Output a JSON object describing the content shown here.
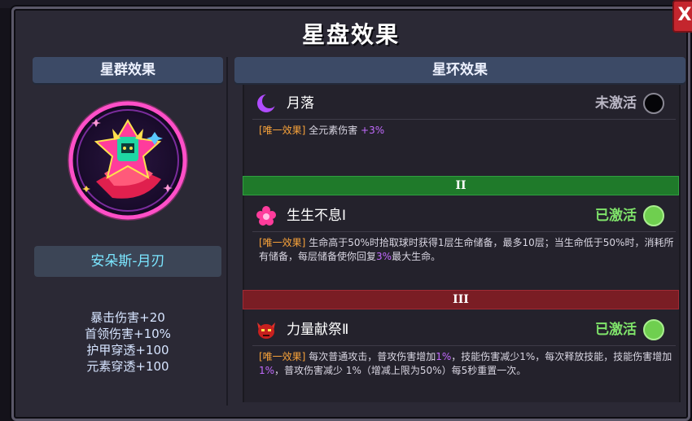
{
  "window": {
    "title": "星盘效果",
    "close_label": "X"
  },
  "left": {
    "header": "星群效果",
    "set_name": "安朵斯-月刃",
    "stats": [
      "暴击伤害+20",
      "首领伤害+10%",
      "护甲穿透+100",
      "元素穿透+100"
    ]
  },
  "right": {
    "header": "星环效果",
    "rings": [
      {
        "name": "月落",
        "status": "未激活",
        "status_color": "#b9b6c4",
        "icon": "crescent-moon-icon",
        "tag": "[唯一效果]",
        "desc_parts": [
          "全元素伤害 ",
          "+3%",
          ""
        ]
      },
      {
        "tier": "II",
        "tier_color": "#1f7a2a",
        "name": "生生不息Ⅰ",
        "status": "已激活",
        "status_color": "#7fe36a",
        "icon": "flower-icon",
        "tag": "[唯一效果]",
        "desc_parts": [
          "生命高于50%时拾取球时获得1层生命储备，最多10层；当生命低于50%时，消耗所有储备，每层储备使你回复",
          "3%",
          "最大生命。"
        ]
      },
      {
        "tier": "III",
        "tier_color": "#7a1d24",
        "name": "力量献祭Ⅱ",
        "status": "已激活",
        "status_color": "#7fe36a",
        "icon": "demon-mask-icon",
        "tag": "[唯一效果]",
        "desc_parts": [
          "每次普通攻击，普攻伤害增加",
          "1%",
          "，技能伤害减少1%，每次释放技能，技能伤害增加",
          "1%",
          "，普攻伤害减少 1%（增减上限为50%）每5秒重置一次。"
        ]
      }
    ]
  }
}
